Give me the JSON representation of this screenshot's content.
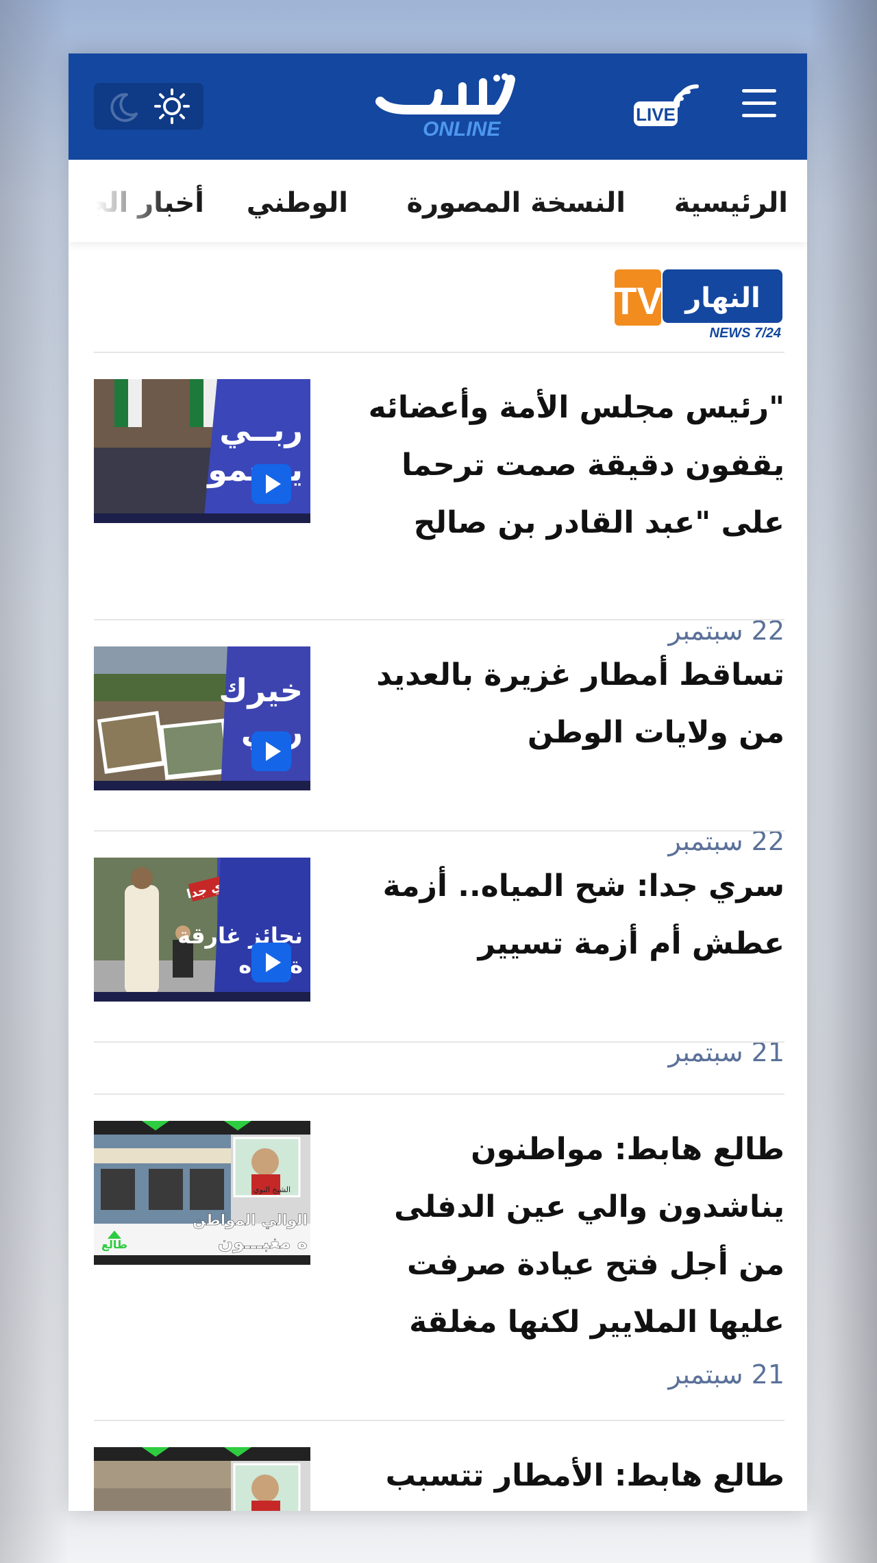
{
  "header": {
    "logo_alt": "النهار ONLINE",
    "live_label": "LIVE"
  },
  "nav": {
    "items": [
      "الرئيسية",
      "النسخة المصورة",
      "الوطني",
      "أخبار الجزائر"
    ]
  },
  "section": {
    "logo_text": "النهار",
    "logo_badge": "TV",
    "logo_sub": "NEWS 7/24"
  },
  "articles": [
    {
      "title": "\"رئيس مجلس الأمة وأعضائه يقفون دقيقة صمت ترحما على \"عبد القادر بن صالح",
      "date": "22 سبتمبر",
      "thumb_text": [
        "ربــي",
        "يرحمو"
      ],
      "thumb_colors": [
        "#2b2f7a",
        "#3b46b8"
      ]
    },
    {
      "title": "تساقط أمطار غزيرة بالعديد من ولايات الوطن",
      "date": "22 سبتمبر",
      "thumb_text": [
        "خيرك",
        "ربي"
      ],
      "thumb_colors": [
        "#2b2f7a",
        "#4a4fc0"
      ]
    },
    {
      "title": "سري جدا: شح المياه.. أزمة عطش أم أزمة تسيير",
      "date": "21 سبتمبر",
      "thumb_text": [
        "سري جدا",
        "نجائز غارقة",
        "ة مياه"
      ],
      "thumb_colors": [
        "#2b2f7a",
        "#3d48b8"
      ]
    },
    {
      "title": "طالع هابط: مواطنون يناشدون والي عين الدفلى من أجل فتح عيادة صرفت عليها الملايير لكنها مغلقة",
      "date": "21 سبتمبر",
      "thumb_text": [
        "الشيخ النوي",
        "الوالي المواطن",
        "ه مغبـــون",
        "طالع"
      ],
      "thumb_colors": [
        "#1f7a3a",
        "#d8d8d8"
      ]
    },
    {
      "title": "طالع هابط: الأمطار تتسبب",
      "date": "",
      "thumb_text": [],
      "thumb_colors": [
        "#1f7a3a",
        "#d8d8d8"
      ]
    }
  ],
  "colors": {
    "brand_blue": "#14479f",
    "date_color": "#5b7199",
    "tv_orange": "#f28c1e",
    "play_blue": "#1565e8"
  }
}
